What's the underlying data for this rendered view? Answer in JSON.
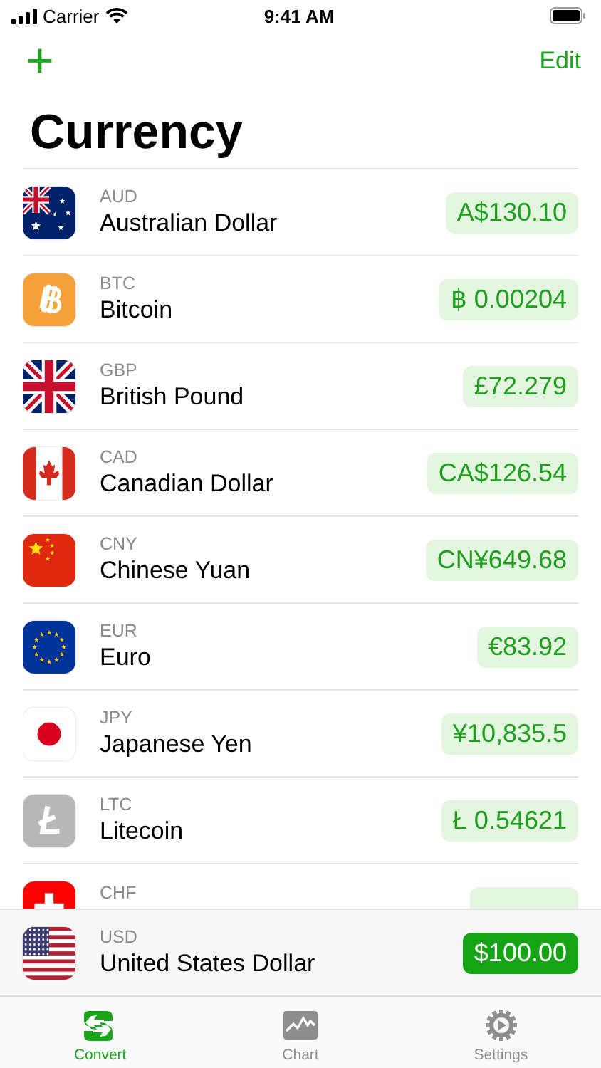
{
  "status_bar": {
    "carrier": "Carrier",
    "time": "9:41 AM"
  },
  "nav": {
    "add": "+",
    "edit": "Edit"
  },
  "title": "Currency",
  "currencies": [
    {
      "code": "AUD",
      "name": "Australian Dollar",
      "value": "A$130.10",
      "kind": "australia"
    },
    {
      "code": "BTC",
      "name": "Bitcoin",
      "value": "฿ 0.00204",
      "kind": "bitcoin"
    },
    {
      "code": "GBP",
      "name": "British Pound",
      "value": "£72.279",
      "kind": "uk"
    },
    {
      "code": "CAD",
      "name": "Canadian Dollar",
      "value": "CA$126.54",
      "kind": "canada"
    },
    {
      "code": "CNY",
      "name": "Chinese Yuan",
      "value": "CN¥649.68",
      "kind": "china"
    },
    {
      "code": "EUR",
      "name": "Euro",
      "value": "€83.92",
      "kind": "eu"
    },
    {
      "code": "JPY",
      "name": "Japanese Yen",
      "value": "¥10,835.5",
      "kind": "japan"
    },
    {
      "code": "LTC",
      "name": "Litecoin",
      "value": "Ł 0.54621",
      "kind": "litecoin"
    },
    {
      "code": "CHF",
      "kind": "switzerland"
    }
  ],
  "base": {
    "code": "USD",
    "name": "United States Dollar",
    "value": "$100.00",
    "kind": "usa"
  },
  "tabs": [
    {
      "label": "Convert",
      "kind": "convert",
      "selected": true
    },
    {
      "label": "Chart",
      "kind": "chart",
      "selected": false
    },
    {
      "label": "Settings",
      "kind": "settings",
      "selected": false
    }
  ]
}
